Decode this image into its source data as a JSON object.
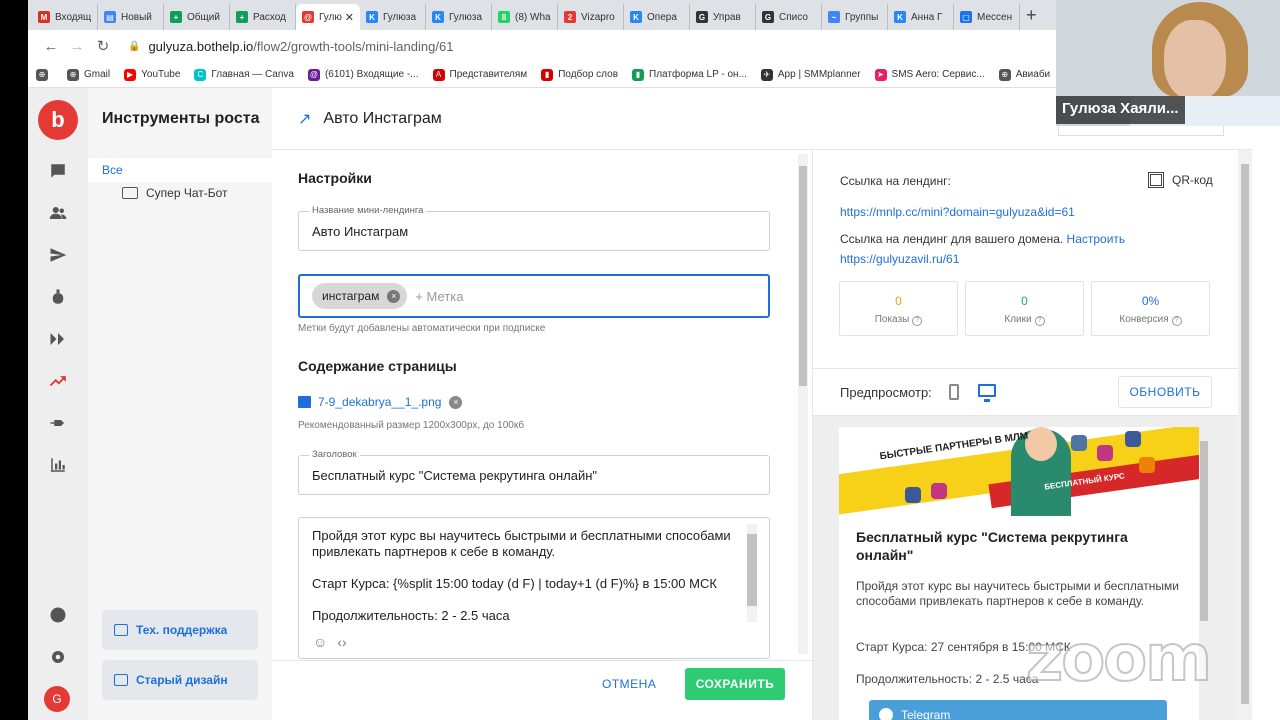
{
  "browser": {
    "tabs": [
      {
        "label": "Входящ",
        "color": "#d93025",
        "glyph": "M"
      },
      {
        "label": "Новый",
        "color": "#4285f4",
        "glyph": "▤"
      },
      {
        "label": "Общий",
        "color": "#0f9d58",
        "glyph": "+"
      },
      {
        "label": "Расход",
        "color": "#0f9d58",
        "glyph": "+"
      },
      {
        "label": "Гулю",
        "color": "#e53935",
        "glyph": "@",
        "active": true
      },
      {
        "label": "Гулюза",
        "color": "#2787f5",
        "glyph": "K"
      },
      {
        "label": "Гулюза",
        "color": "#2787f5",
        "glyph": "K"
      },
      {
        "label": "(8) Wha",
        "color": "#25d366",
        "glyph": "8"
      },
      {
        "label": "Vizapro",
        "color": "#e53935",
        "glyph": "2"
      },
      {
        "label": "Опера",
        "color": "#2787f5",
        "glyph": "K"
      },
      {
        "label": "Управ",
        "color": "#333333",
        "glyph": "G"
      },
      {
        "label": "Списо",
        "color": "#333333",
        "glyph": "G"
      },
      {
        "label": "Группы",
        "color": "#4285f4",
        "glyph": "~"
      },
      {
        "label": "Анна Г",
        "color": "#2787f5",
        "glyph": "K"
      },
      {
        "label": "Мессен",
        "color": "#1a73e8",
        "glyph": "▢"
      }
    ],
    "url_host": "gulyuza.bothelp.io",
    "url_path": "/flow2/growth-tools/mini-landing/61",
    "bookmarks": [
      {
        "label": "",
        "color": "#555555",
        "glyph": "⊕"
      },
      {
        "label": "Gmail",
        "color": "#555555",
        "glyph": "⊕"
      },
      {
        "label": "YouTube",
        "color": "#ff0000",
        "glyph": "▶"
      },
      {
        "label": "Главная — Canva",
        "color": "#00c4cc",
        "glyph": "C"
      },
      {
        "label": "(6101) Входящие -...",
        "color": "#6a1b9a",
        "glyph": "@"
      },
      {
        "label": "Представителям",
        "color": "#d50000",
        "glyph": "A"
      },
      {
        "label": "Подбор слов",
        "color": "#d50000",
        "glyph": "▮"
      },
      {
        "label": "Платформа LP - он...",
        "color": "#0f9d58",
        "glyph": "▮"
      },
      {
        "label": "App | SMMplanner",
        "color": "#333333",
        "glyph": "✈"
      },
      {
        "label": "SMS Aero: Сервис...",
        "color": "#e91e63",
        "glyph": "➤"
      },
      {
        "label": "Авиаби",
        "color": "#555555",
        "glyph": "⊕"
      }
    ]
  },
  "sidebar": {
    "title": "Инструменты роста",
    "all_label": "Все",
    "folder_label": "Супер Чат-Бот",
    "support_label": "Тех. поддержка",
    "old_design_label": "Старый дизайн",
    "avatar_letter": "G"
  },
  "header": {
    "title": "Авто Инстаграм"
  },
  "settings": {
    "section_title": "Настройки",
    "name_label": "Название мини-лендинга",
    "name_value": "Авто Инстаграм",
    "tag_chip": "инстаграм",
    "tag_placeholder": "+ Метка",
    "tag_hint": "Метки будут добавлены автоматически при подписке"
  },
  "content": {
    "section_title": "Содержание страницы",
    "file_name": "7-9_dekabrya__1_.png",
    "file_hint": "Рекомендованный размер 1200x300px, до 100кб",
    "heading_label": "Заголовок",
    "heading_value": "Бесплатный курс \"Система рекрутинга онлайн\"",
    "body_line1": "Пройдя этот курс вы научитесь быстрыми и бесплатными способами привлекать партнеров к себе в команду.",
    "body_line2": "Старт Курса: {%split 15:00 today (d F) | today+1 (d F)%} в 15:00 МСК",
    "body_line3": "Продолжительность: 2 - 2.5 часа"
  },
  "footer": {
    "cancel_label": "ОТМЕНА",
    "save_label": "СОХРАНИТЬ"
  },
  "links": {
    "landing_label": "Ссылка на лендинг:",
    "qr_label": "QR-код",
    "landing_url": "https://mnlp.cc/mini?domain=gulyuza&id=61",
    "domain_text": "Ссылка на лендинг для вашего домена.",
    "domain_setup": "Настроить",
    "domain_url": "https://gulyuzavil.ru/61"
  },
  "stats": [
    {
      "value": "0",
      "label": "Показы",
      "color": "#f39c12"
    },
    {
      "value": "0",
      "label": "Клики",
      "color": "#27ae60"
    },
    {
      "value": "0%",
      "label": "Конверсия",
      "color": "#1e6fd9"
    }
  ],
  "preview": {
    "label": "Предпросмотр:",
    "refresh_label": "ОБНОВИТЬ",
    "banner_text1": "БЫСТРЫЕ ПАРТНЕРЫ В МЛМ",
    "banner_text2": "БЕСПЛАТНЫЙ КУРС",
    "card_title": "Бесплатный курс \"Система рекрутинга онлайн\"",
    "card_text": "Пройдя этот курс вы научитесь быстрыми и бесплатными способами привлекать партнеров к себе в команду.",
    "card_start": "Старт Курса: 27 сентября в 15:00 МСК",
    "card_duration": "Продолжительность: 2 - 2.5 часа",
    "telegram_label": "Telegram"
  },
  "webcam": {
    "name": "Гулюза Хаяли..."
  },
  "watermark": "zoom",
  "colors": {
    "brand": "#e53935",
    "accent": "#1e6fd9",
    "save": "#2ecc71"
  }
}
